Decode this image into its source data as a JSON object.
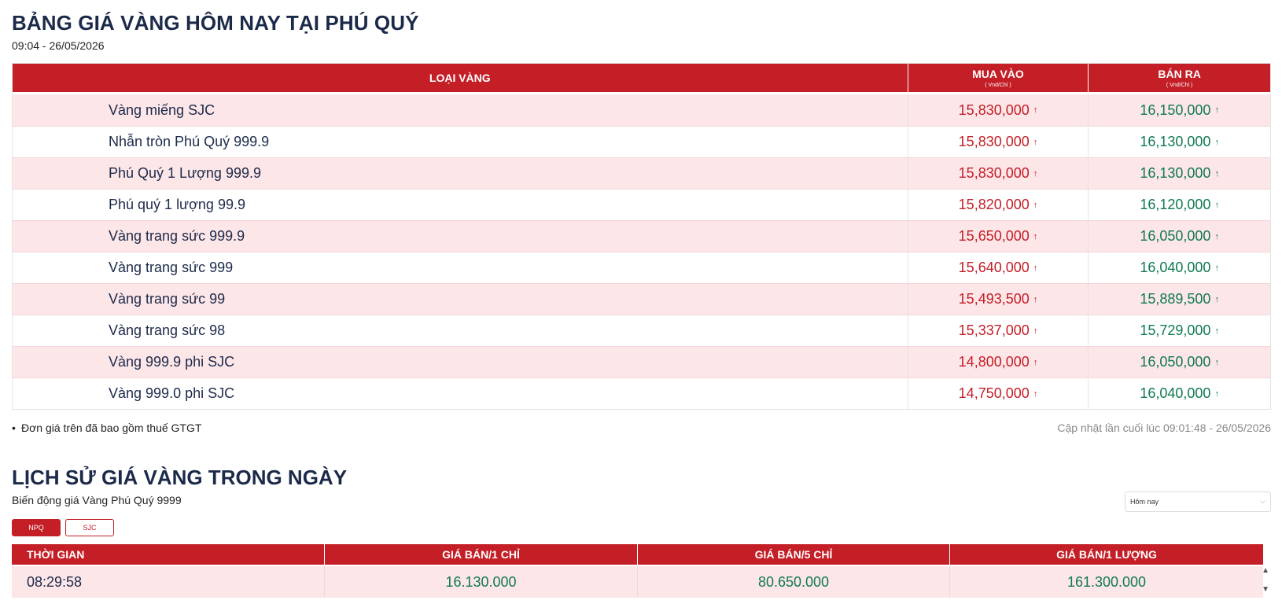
{
  "header": {
    "title": "BẢNG GIÁ VÀNG HÔM NAY TẠI PHÚ QUÝ",
    "datetime": "09:04 - 26/05/2026"
  },
  "price_table": {
    "col_type": "LOẠI VÀNG",
    "col_buy": "MUA VÀO",
    "col_sell": "BÁN RA",
    "unit": "( Vnd/Chỉ )",
    "rows": [
      {
        "name": "Vàng miếng SJC",
        "buy": "15,830,000",
        "sell": "16,150,000"
      },
      {
        "name": "Nhẫn tròn Phú Quý 999.9",
        "buy": "15,830,000",
        "sell": "16,130,000"
      },
      {
        "name": "Phú Quý 1 Lượng 999.9",
        "buy": "15,830,000",
        "sell": "16,130,000"
      },
      {
        "name": "Phú quý 1 lượng 99.9",
        "buy": "15,820,000",
        "sell": "16,120,000"
      },
      {
        "name": "Vàng trang sức 999.9",
        "buy": "15,650,000",
        "sell": "16,050,000"
      },
      {
        "name": "Vàng trang sức 999",
        "buy": "15,640,000",
        "sell": "16,040,000"
      },
      {
        "name": "Vàng trang sức 99",
        "buy": "15,493,500",
        "sell": "15,889,500"
      },
      {
        "name": "Vàng trang sức 98",
        "buy": "15,337,000",
        "sell": "15,729,000"
      },
      {
        "name": "Vàng 999.9 phi SJC",
        "buy": "14,800,000",
        "sell": "16,050,000"
      },
      {
        "name": "Vàng 999.0 phi SJC",
        "buy": "14,750,000",
        "sell": "16,040,000"
      }
    ],
    "arrow_glyph": "↑"
  },
  "note": "Đơn giá trên đã bao gồm thuế GTGT",
  "last_updated": "Cập nhật lần cuối lúc 09:01:48 - 26/05/2026",
  "history": {
    "title": "LỊCH SỬ GIÁ VÀNG TRONG NGÀY",
    "subtitle": "Biến động giá Vàng Phú Quý 9999",
    "range_select": "Hôm nay",
    "tabs": [
      "NPQ",
      "SJC"
    ],
    "columns": [
      "THỜI GIAN",
      "GIÁ BÁN/1 CHỈ",
      "GIÁ BÁN/5 CHỈ",
      "GIÁ BÁN/1 LƯỢNG"
    ],
    "rows": [
      {
        "time": "08:29:58",
        "p1": "16.130.000",
        "p5": "80.650.000",
        "pl": "161.300.000"
      }
    ]
  },
  "colors": {
    "accent_red": "#c41e26",
    "price_green": "#0e7a50",
    "title_navy": "#1c2a4a",
    "row_pink": "#fde6e8"
  }
}
